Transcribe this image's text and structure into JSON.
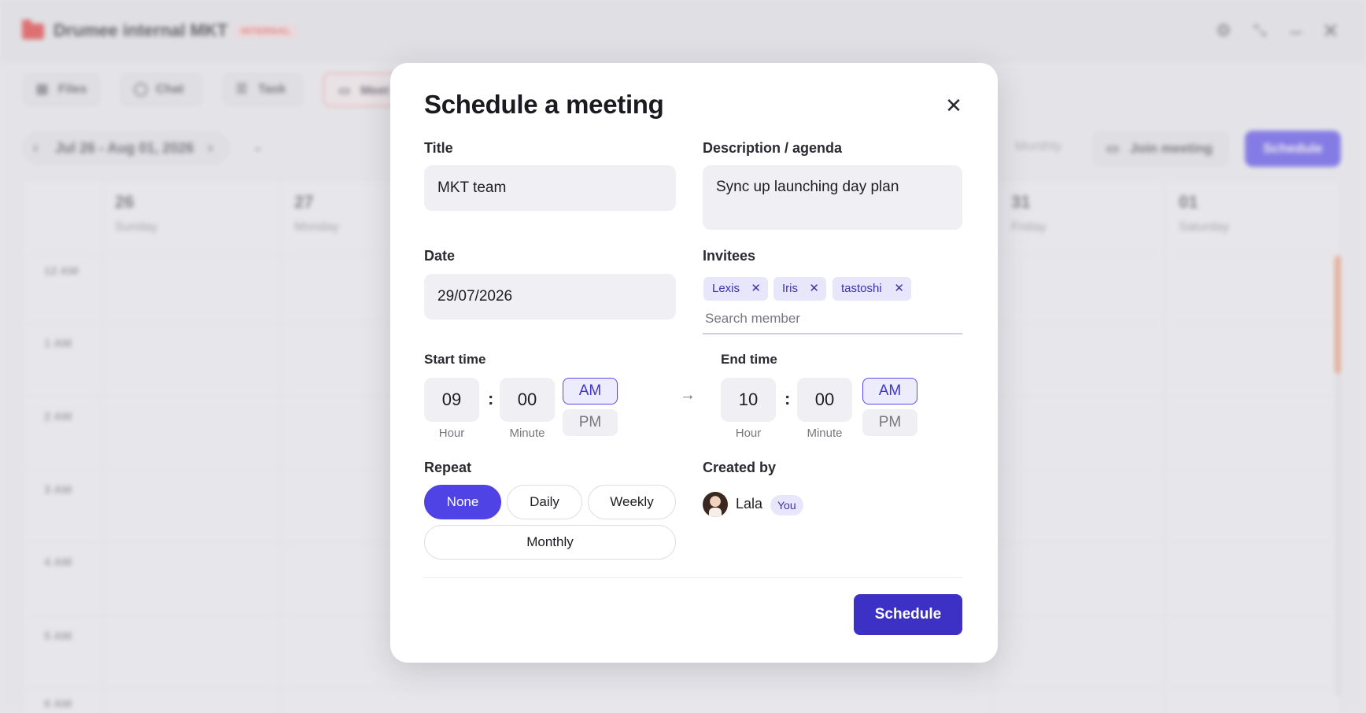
{
  "app": {
    "title": "Drumee internal MKT",
    "badge": "INTERNAL",
    "tabs": [
      {
        "label": "Files",
        "icon": "file-icon"
      },
      {
        "label": "Chat",
        "icon": "chat-icon"
      },
      {
        "label": "Task",
        "icon": "task-icon"
      },
      {
        "label": "Meet",
        "icon": "video-icon"
      }
    ],
    "date_range": "Jul 26 - Aug 01, 2026",
    "view_label": "Monthly",
    "join_label": "Join meeting",
    "schedule_label": "Schedule",
    "days": [
      {
        "num": "26",
        "name": "Sunday"
      },
      {
        "num": "27",
        "name": "Monday"
      },
      {
        "num": "31",
        "name": "Friday"
      },
      {
        "num": "01",
        "name": "Saturday"
      }
    ],
    "hours": [
      "12 AM",
      "1 AM",
      "2 AM",
      "3 AM",
      "4 AM",
      "5 AM",
      "6 AM"
    ]
  },
  "modal": {
    "title": "Schedule a meeting",
    "title_label": "Title",
    "title_value": "MKT team",
    "description_label": "Description / agenda",
    "description_value": "Sync up launching day plan",
    "date_label": "Date",
    "date_value": "29/07/2026",
    "invitees_label": "Invitees",
    "invitees": [
      "Lexis",
      "Iris",
      "tastoshi"
    ],
    "search_placeholder": "Search member",
    "start_label": "Start time",
    "start": {
      "hour": "09",
      "minute": "00",
      "period": "AM"
    },
    "end_label": "End time",
    "end": {
      "hour": "10",
      "minute": "00",
      "period": "AM"
    },
    "hour_caption": "Hour",
    "minute_caption": "Minute",
    "am_label": "AM",
    "pm_label": "PM",
    "repeat_label": "Repeat",
    "repeat_options": [
      "None",
      "Daily",
      "Weekly",
      "Monthly"
    ],
    "repeat_selected": "None",
    "created_by_label": "Created by",
    "creator_name": "Lala",
    "creator_badge": "You",
    "schedule_button": "Schedule",
    "accent_color": "#4f43e6"
  }
}
